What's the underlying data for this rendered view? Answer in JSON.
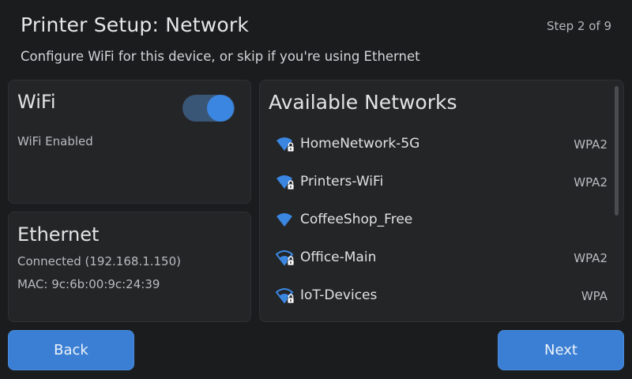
{
  "header": {
    "title": "Printer Setup: Network",
    "step": "Step 2 of 9",
    "subtitle": "Configure WiFi for this device, or skip if you're using Ethernet"
  },
  "wifi": {
    "title": "WiFi",
    "status": "WiFi Enabled",
    "toggle_on": true
  },
  "ethernet": {
    "title": "Ethernet",
    "status": "Connected (192.168.1.150)",
    "mac": "MAC: 9c:6b:00:9c:24:39"
  },
  "networks": {
    "title": "Available Networks",
    "items": [
      {
        "name": "HomeNetwork-5G",
        "security": "WPA2",
        "locked": true,
        "signal": "full"
      },
      {
        "name": "Printers-WiFi",
        "security": "WPA2",
        "locked": true,
        "signal": "full"
      },
      {
        "name": "CoffeeShop_Free",
        "security": "",
        "locked": false,
        "signal": "full"
      },
      {
        "name": "Office-Main",
        "security": "WPA2",
        "locked": true,
        "signal": "medium"
      },
      {
        "name": "IoT-Devices",
        "security": "WPA",
        "locked": true,
        "signal": "medium"
      }
    ]
  },
  "buttons": {
    "back": "Back",
    "next": "Next"
  },
  "colors": {
    "accent": "#3a7fd4",
    "background": "#1b1c1e",
    "panel": "#242527",
    "wifi_icon": "#3a86e0"
  }
}
